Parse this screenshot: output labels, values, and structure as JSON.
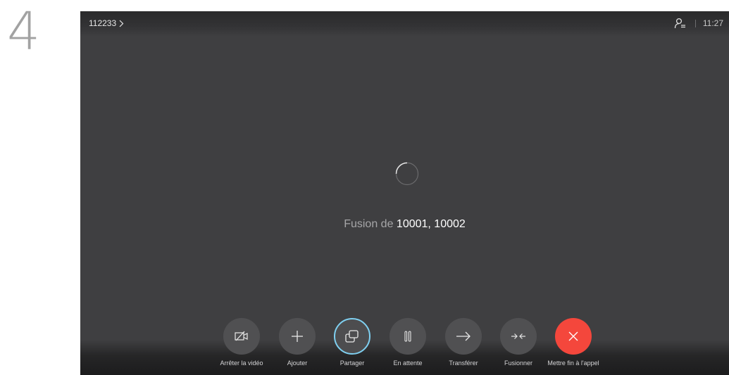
{
  "step": {
    "number": "4"
  },
  "header": {
    "call_id": "112233",
    "time": "11:27",
    "icons": {
      "chevron": "chevron-right-icon",
      "participants": "participants-list-icon"
    }
  },
  "status": {
    "prefix": "Fusion de",
    "numbers": "10001, 10002"
  },
  "controls": [
    {
      "id": "stop-video",
      "label": "Arrêter la vidéo",
      "icon": "video-off-icon"
    },
    {
      "id": "add",
      "label": "Ajouter",
      "icon": "plus-icon"
    },
    {
      "id": "share",
      "label": "Partager",
      "icon": "share-icon",
      "active": true
    },
    {
      "id": "hold",
      "label": "En attente",
      "icon": "pause-icon"
    },
    {
      "id": "transfer",
      "label": "Transférer",
      "icon": "arrow-right-icon"
    },
    {
      "id": "merge",
      "label": "Fusionner",
      "icon": "merge-icon"
    },
    {
      "id": "end-call",
      "label": "Mettre fin à l'appel",
      "icon": "close-icon"
    }
  ],
  "colors": {
    "screen_bg": "#3f3f41",
    "button_bg": "#505052",
    "active_ring": "#7fd0f1",
    "end_call": "#f4473c"
  }
}
